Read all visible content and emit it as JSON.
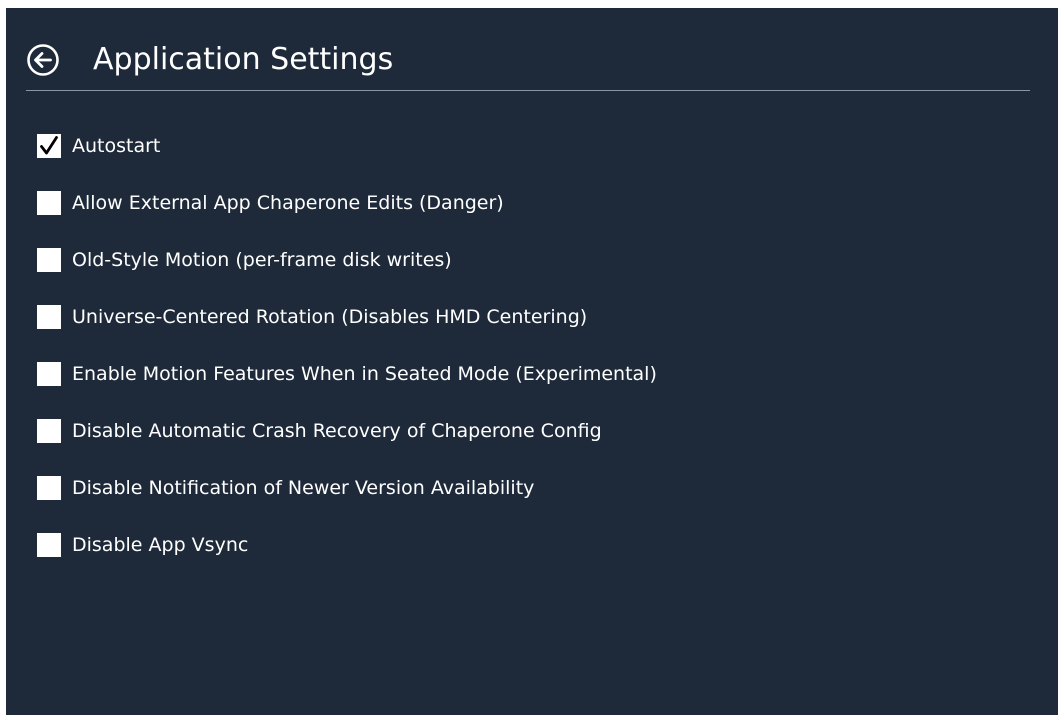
{
  "header": {
    "title": "Application Settings",
    "back_icon": "circle-arrow-left-icon"
  },
  "colors": {
    "panel_background": "#1e2a3a",
    "text": "#ffffff",
    "checkbox_fill": "#ffffff",
    "checkmark": "#000000",
    "divider": "#8a94a2"
  },
  "options": [
    {
      "label": "Autostart",
      "checked": true
    },
    {
      "label": "Allow External App Chaperone Edits (Danger)",
      "checked": false
    },
    {
      "label": "Old-Style Motion (per-frame disk writes)",
      "checked": false
    },
    {
      "label": "Universe-Centered Rotation (Disables HMD Centering)",
      "checked": false
    },
    {
      "label": "Enable Motion Features When in Seated Mode (Experimental)",
      "checked": false
    },
    {
      "label": "Disable Automatic Crash Recovery of Chaperone Config",
      "checked": false
    },
    {
      "label": "Disable Notification of Newer Version Availability",
      "checked": false
    },
    {
      "label": "Disable App Vsync",
      "checked": false
    }
  ]
}
